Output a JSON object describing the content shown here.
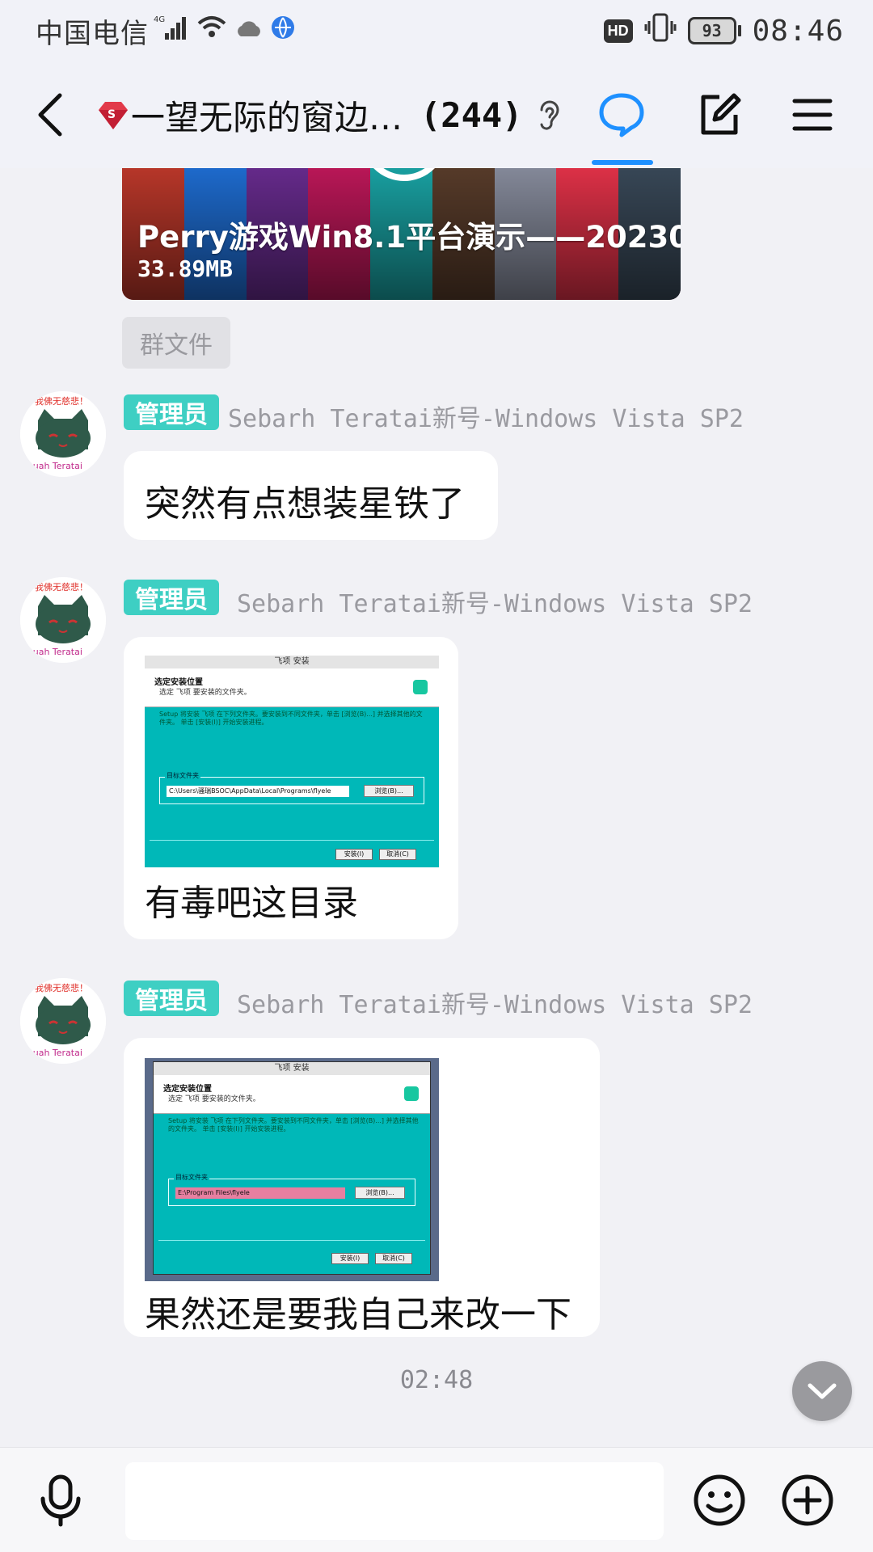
{
  "status_bar": {
    "carrier": "中国电信",
    "network": "4G",
    "battery": "93",
    "time": "08:46",
    "hd": "HD"
  },
  "header": {
    "title": "一望无际的窗边…",
    "member_count": "(244)"
  },
  "messages": {
    "video": {
      "title": "Perry游戏Win8.1平台演示——20230…",
      "size": "33.89MB",
      "tag": "群文件"
    },
    "m1": {
      "badge": "管理员",
      "sender": "Sebarh Teratai新号-Windows Vista SP2",
      "text": "突然有点想装星铁了"
    },
    "m2": {
      "badge": "管理员",
      "sender": "Sebarh Teratai新号-Windows Vista SP2",
      "text": "有毒吧这目录",
      "shot": {
        "window_title": "飞项 安装",
        "heading": "选定安装位置",
        "sub": "选定 飞项 要安装的文件夹。",
        "desc": "Setup 将安装 飞项 在下列文件夹。要安装到不同文件夹，单击 [浏览(B)...] 并选择其他的文件夹。 单击 [安装(I)] 开始安装进程。",
        "group_label": "目标文件夹",
        "path": "C:\\Users\\骚瑞BSOC\\AppData\\Local\\Programs\\flyele",
        "browse": "浏览(B)...",
        "install": "安装(I)",
        "cancel": "取消(C)"
      }
    },
    "m3": {
      "badge": "管理员",
      "sender": "Sebarh Teratai新号-Windows Vista SP2",
      "text": "果然还是要我自己来改一下",
      "shot": {
        "window_title": "飞项 安装",
        "heading": "选定安装位置",
        "sub": "选定 飞项 要安装的文件夹。",
        "desc": "Setup 将安装 飞项 在下列文件夹。要安装到不同文件夹，单击 [浏览(B)...] 并选择其他的文件夹。 单击 [安装(I)] 开始安装进程。",
        "group_label": "目标文件夹",
        "path": "E:\\Program Files\\flyele",
        "browse": "浏览(B)...",
        "install": "安装(I)",
        "cancel": "取消(C)"
      }
    },
    "time_separator": "02:48"
  },
  "input": {
    "placeholder": ""
  },
  "colors": {
    "accent": "#1e90ff",
    "admin_badge": "#3ecfc3",
    "installer_bg": "#00b8b8"
  }
}
